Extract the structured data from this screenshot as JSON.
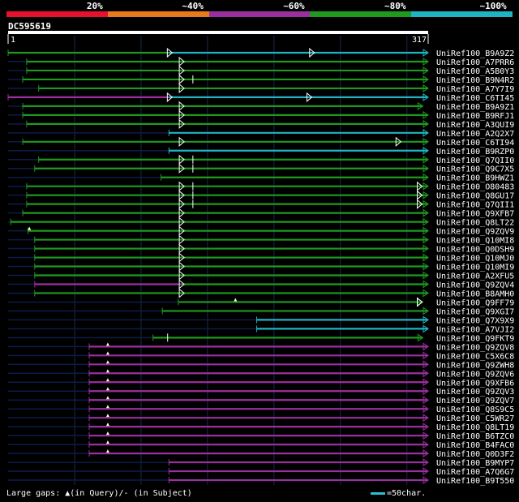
{
  "legend": {
    "labels": [
      "20%",
      "~40%",
      "~60%",
      "~80%",
      "~100%"
    ],
    "colors": [
      "#e8112d",
      "#e87a1e",
      "#9b2fa0",
      "#1f9a1f",
      "#1fb4c3"
    ]
  },
  "query": {
    "name": "DC595619",
    "start_label": "1",
    "end_label": "317",
    "length": 317
  },
  "footer": {
    "gaps_text": "Large gaps: ▲(in Query)/- (in Subject)",
    "scale_text": "=50char."
  },
  "hits": [
    {
      "name": "UniRef100_B9A9Z2",
      "segments": [
        {
          "s": 1,
          "e": 122,
          "c": "green"
        },
        {
          "s": 122,
          "e": 317,
          "c": "cyan"
        }
      ],
      "markers": [
        {
          "pos": 122,
          "type": "tri"
        },
        {
          "pos": 229,
          "type": "tri"
        }
      ]
    },
    {
      "name": "UniRef100_A7PRR6",
      "segments": [
        {
          "s": 15,
          "e": 317,
          "c": "green"
        }
      ],
      "markers": [
        {
          "pos": 131,
          "type": "tri"
        }
      ]
    },
    {
      "name": "UniRef100_A5B0Y3",
      "segments": [
        {
          "s": 15,
          "e": 317,
          "c": "green"
        }
      ],
      "markers": [
        {
          "pos": 131,
          "type": "tri"
        }
      ]
    },
    {
      "name": "UniRef100_B9N4R2",
      "segments": [
        {
          "s": 12,
          "e": 317,
          "c": "green"
        }
      ],
      "markers": [
        {
          "pos": 131,
          "type": "tri"
        },
        {
          "pos": 140,
          "type": "tick"
        }
      ]
    },
    {
      "name": "UniRef100_A7Y7I9",
      "segments": [
        {
          "s": 24,
          "e": 317,
          "c": "green"
        }
      ],
      "markers": [
        {
          "pos": 131,
          "type": "tri"
        }
      ]
    },
    {
      "name": "UniRef100_C6TI45",
      "segments": [
        {
          "s": 1,
          "e": 122,
          "c": "purple"
        },
        {
          "s": 122,
          "e": 317,
          "c": "cyan"
        }
      ],
      "markers": [
        {
          "pos": 122,
          "type": "tri"
        },
        {
          "pos": 227,
          "type": "tri"
        }
      ]
    },
    {
      "name": "UniRef100_B9A9Z1",
      "segments": [
        {
          "s": 12,
          "e": 313,
          "c": "green"
        }
      ],
      "markers": [
        {
          "pos": 131,
          "type": "tri"
        }
      ]
    },
    {
      "name": "UniRef100_B9RFJ1",
      "segments": [
        {
          "s": 12,
          "e": 317,
          "c": "green"
        }
      ],
      "markers": [
        {
          "pos": 131,
          "type": "tri"
        }
      ]
    },
    {
      "name": "UniRef100_A3QUI9",
      "segments": [
        {
          "s": 15,
          "e": 317,
          "c": "green"
        }
      ],
      "markers": [
        {
          "pos": 131,
          "type": "tri"
        }
      ]
    },
    {
      "name": "UniRef100_A2Q2X7",
      "segments": [
        {
          "s": 122,
          "e": 317,
          "c": "cyan"
        }
      ],
      "markers": []
    },
    {
      "name": "UniRef100_C6TI94",
      "segments": [
        {
          "s": 12,
          "e": 317,
          "c": "green"
        }
      ],
      "markers": [
        {
          "pos": 131,
          "type": "tri"
        },
        {
          "pos": 294,
          "type": "tri"
        }
      ]
    },
    {
      "name": "UniRef100_B9RZP0",
      "segments": [
        {
          "s": 122,
          "e": 317,
          "c": "cyan"
        }
      ],
      "markers": []
    },
    {
      "name": "UniRef100_Q7QII0",
      "segments": [
        {
          "s": 24,
          "e": 317,
          "c": "green"
        }
      ],
      "markers": [
        {
          "pos": 131,
          "type": "tri"
        },
        {
          "pos": 140,
          "type": "tick"
        }
      ]
    },
    {
      "name": "UniRef100_Q9C7X5",
      "segments": [
        {
          "s": 21,
          "e": 317,
          "c": "green"
        }
      ],
      "markers": [
        {
          "pos": 131,
          "type": "tri"
        },
        {
          "pos": 140,
          "type": "tick"
        }
      ]
    },
    {
      "name": "UniRef100_B9HWZ1",
      "segments": [
        {
          "s": 116,
          "e": 317,
          "c": "green"
        }
      ],
      "markers": []
    },
    {
      "name": "UniRef100_O80483",
      "segments": [
        {
          "s": 15,
          "e": 317,
          "c": "green"
        }
      ],
      "markers": [
        {
          "pos": 131,
          "type": "tri"
        },
        {
          "pos": 140,
          "type": "tick"
        },
        {
          "pos": 310,
          "type": "tri"
        }
      ]
    },
    {
      "name": "UniRef100_Q8GU17",
      "segments": [
        {
          "s": 15,
          "e": 317,
          "c": "green"
        }
      ],
      "markers": [
        {
          "pos": 131,
          "type": "tri"
        },
        {
          "pos": 140,
          "type": "tick"
        },
        {
          "pos": 310,
          "type": "tri"
        }
      ]
    },
    {
      "name": "UniRef100_Q7QII1",
      "segments": [
        {
          "s": 15,
          "e": 317,
          "c": "green"
        }
      ],
      "markers": [
        {
          "pos": 131,
          "type": "tri"
        },
        {
          "pos": 140,
          "type": "tick"
        },
        {
          "pos": 310,
          "type": "tri"
        }
      ]
    },
    {
      "name": "UniRef100_Q9XFB7",
      "segments": [
        {
          "s": 12,
          "e": 317,
          "c": "green"
        }
      ],
      "markers": [
        {
          "pos": 131,
          "type": "tri"
        }
      ]
    },
    {
      "name": "UniRef100_Q8LT22",
      "segments": [
        {
          "s": 3,
          "e": 317,
          "c": "green"
        }
      ],
      "markers": [
        {
          "pos": 131,
          "type": "tri"
        }
      ]
    },
    {
      "name": "UniRef100_Q9ZQV9",
      "segments": [
        {
          "s": 16,
          "e": 317,
          "c": "green"
        }
      ],
      "markers": [
        {
          "pos": 17,
          "type": "up"
        },
        {
          "pos": 131,
          "type": "tri"
        }
      ]
    },
    {
      "name": "UniRef100_Q10MI8",
      "segments": [
        {
          "s": 21,
          "e": 317,
          "c": "green"
        }
      ],
      "markers": [
        {
          "pos": 131,
          "type": "tri"
        }
      ]
    },
    {
      "name": "UniRef100_Q0DSH9",
      "segments": [
        {
          "s": 21,
          "e": 317,
          "c": "green"
        }
      ],
      "markers": [
        {
          "pos": 131,
          "type": "tri"
        }
      ]
    },
    {
      "name": "UniRef100_Q10MJ0",
      "segments": [
        {
          "s": 21,
          "e": 317,
          "c": "green"
        }
      ],
      "markers": [
        {
          "pos": 131,
          "type": "tri"
        }
      ]
    },
    {
      "name": "UniRef100_Q10MI9",
      "segments": [
        {
          "s": 21,
          "e": 317,
          "c": "green"
        }
      ],
      "markers": [
        {
          "pos": 131,
          "type": "tri"
        }
      ]
    },
    {
      "name": "UniRef100_A2XFU5",
      "segments": [
        {
          "s": 21,
          "e": 317,
          "c": "green"
        }
      ],
      "markers": [
        {
          "pos": 131,
          "type": "tri"
        }
      ]
    },
    {
      "name": "UniRef100_Q9ZQV4",
      "segments": [
        {
          "s": 21,
          "e": 131,
          "c": "purple"
        },
        {
          "s": 131,
          "e": 317,
          "c": "green"
        }
      ],
      "markers": [
        {
          "pos": 131,
          "type": "tri"
        }
      ]
    },
    {
      "name": "UniRef100_B8AMH0",
      "segments": [
        {
          "s": 21,
          "e": 317,
          "c": "green"
        }
      ],
      "markers": [
        {
          "pos": 131,
          "type": "tri"
        }
      ]
    },
    {
      "name": "UniRef100_Q9FF79",
      "segments": [
        {
          "s": 129,
          "e": 313,
          "c": "green"
        }
      ],
      "markers": [
        {
          "pos": 172,
          "type": "up"
        },
        {
          "pos": 310,
          "type": "tri"
        }
      ]
    },
    {
      "name": "UniRef100_Q9XGI7",
      "segments": [
        {
          "s": 117,
          "e": 317,
          "c": "green"
        }
      ],
      "markers": []
    },
    {
      "name": "UniRef100_Q7X9X9",
      "segments": [
        {
          "s": 188,
          "e": 317,
          "c": "cyan"
        }
      ],
      "markers": []
    },
    {
      "name": "UniRef100_A7VJI2",
      "segments": [
        {
          "s": 188,
          "e": 317,
          "c": "cyan"
        }
      ],
      "markers": []
    },
    {
      "name": "UniRef100_Q9FKT9",
      "segments": [
        {
          "s": 110,
          "e": 121,
          "c": "green"
        },
        {
          "s": 121,
          "e": 313,
          "c": "green"
        }
      ],
      "markers": [
        {
          "pos": 121,
          "type": "tick"
        }
      ]
    },
    {
      "name": "UniRef100_Q9ZQV8",
      "segments": [
        {
          "s": 62,
          "e": 317,
          "c": "purple"
        }
      ],
      "markers": [
        {
          "pos": 76,
          "type": "up"
        }
      ]
    },
    {
      "name": "UniRef100_C5X6C8",
      "segments": [
        {
          "s": 62,
          "e": 317,
          "c": "purple"
        }
      ],
      "markers": [
        {
          "pos": 76,
          "type": "up"
        }
      ]
    },
    {
      "name": "UniRef100_Q9ZWH8",
      "segments": [
        {
          "s": 62,
          "e": 317,
          "c": "purple"
        }
      ],
      "markers": [
        {
          "pos": 76,
          "type": "up"
        }
      ]
    },
    {
      "name": "UniRef100_Q9ZQV6",
      "segments": [
        {
          "s": 62,
          "e": 317,
          "c": "purple"
        }
      ],
      "markers": [
        {
          "pos": 76,
          "type": "up"
        }
      ]
    },
    {
      "name": "UniRef100_Q9XFB6",
      "segments": [
        {
          "s": 62,
          "e": 317,
          "c": "purple"
        }
      ],
      "markers": [
        {
          "pos": 76,
          "type": "up"
        }
      ]
    },
    {
      "name": "UniRef100_Q9ZQV3",
      "segments": [
        {
          "s": 62,
          "e": 317,
          "c": "purple"
        }
      ],
      "markers": [
        {
          "pos": 76,
          "type": "up"
        }
      ]
    },
    {
      "name": "UniRef100_Q9ZQV7",
      "segments": [
        {
          "s": 62,
          "e": 317,
          "c": "purple"
        }
      ],
      "markers": [
        {
          "pos": 76,
          "type": "up"
        }
      ]
    },
    {
      "name": "UniRef100_Q8S9C5",
      "segments": [
        {
          "s": 62,
          "e": 317,
          "c": "purple"
        }
      ],
      "markers": [
        {
          "pos": 76,
          "type": "up"
        }
      ]
    },
    {
      "name": "UniRef100_C5WR27",
      "segments": [
        {
          "s": 62,
          "e": 317,
          "c": "purple"
        }
      ],
      "markers": [
        {
          "pos": 76,
          "type": "up"
        }
      ]
    },
    {
      "name": "UniRef100_Q8LT19",
      "segments": [
        {
          "s": 62,
          "e": 317,
          "c": "purple"
        }
      ],
      "markers": [
        {
          "pos": 76,
          "type": "up"
        }
      ]
    },
    {
      "name": "UniRef100_B6TZC0",
      "segments": [
        {
          "s": 62,
          "e": 317,
          "c": "purple"
        }
      ],
      "markers": [
        {
          "pos": 76,
          "type": "up"
        }
      ]
    },
    {
      "name": "UniRef100_B4FAC0",
      "segments": [
        {
          "s": 62,
          "e": 317,
          "c": "purple"
        }
      ],
      "markers": [
        {
          "pos": 76,
          "type": "up"
        }
      ]
    },
    {
      "name": "UniRef100_Q0D3F2",
      "segments": [
        {
          "s": 62,
          "e": 317,
          "c": "purple"
        }
      ],
      "markers": [
        {
          "pos": 76,
          "type": "up"
        }
      ]
    },
    {
      "name": "UniRef100_B9MYP7",
      "segments": [
        {
          "s": 122,
          "e": 317,
          "c": "purple"
        }
      ],
      "markers": []
    },
    {
      "name": "UniRef100_A7Q6G7",
      "segments": [
        {
          "s": 122,
          "e": 317,
          "c": "purple"
        }
      ],
      "markers": []
    },
    {
      "name": "UniRef100_B9T550",
      "segments": [
        {
          "s": 122,
          "e": 317,
          "c": "purple"
        }
      ],
      "markers": []
    }
  ]
}
